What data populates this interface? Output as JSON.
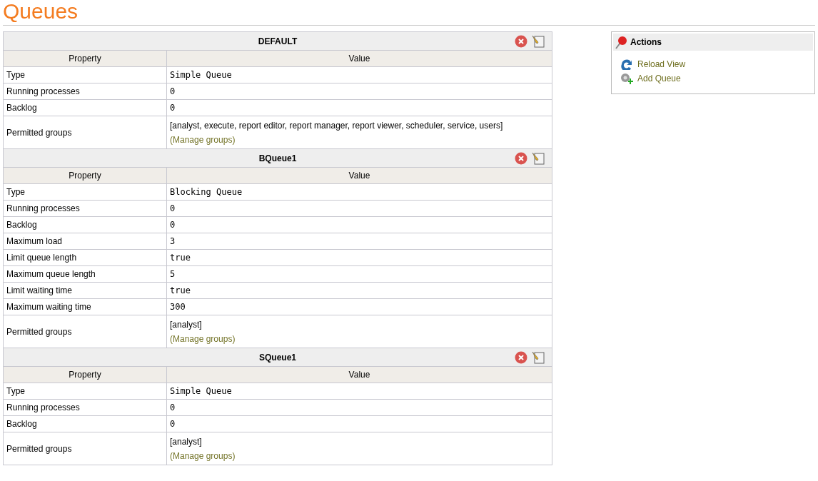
{
  "title": "Queues",
  "queues": [
    {
      "name": "DEFAULT",
      "columns": [
        "Property",
        "Value"
      ],
      "rows": [
        {
          "kind": "code",
          "property": "Type",
          "value": "Simple Queue"
        },
        {
          "kind": "code",
          "property": "Running processes",
          "value": "0"
        },
        {
          "kind": "code",
          "property": "Backlog",
          "value": "0"
        },
        {
          "kind": "groups",
          "property": "Permitted groups",
          "value": "[analyst, execute, report editor, report manager, report viewer, scheduler, service, users]",
          "link": "(Manage groups)"
        }
      ]
    },
    {
      "name": "BQueue1",
      "columns": [
        "Property",
        "Value"
      ],
      "rows": [
        {
          "kind": "code",
          "property": "Type",
          "value": "Blocking Queue"
        },
        {
          "kind": "code",
          "property": "Running processes",
          "value": "0"
        },
        {
          "kind": "code",
          "property": "Backlog",
          "value": "0"
        },
        {
          "kind": "code",
          "property": "Maximum load",
          "value": "3"
        },
        {
          "kind": "code",
          "property": "Limit queue length",
          "value": "true"
        },
        {
          "kind": "code",
          "property": "Maximum queue length",
          "value": "5"
        },
        {
          "kind": "code",
          "property": "Limit waiting time",
          "value": "true"
        },
        {
          "kind": "code",
          "property": "Maximum waiting time",
          "value": "300"
        },
        {
          "kind": "groups",
          "property": "Permitted groups",
          "value": "[analyst]",
          "link": "(Manage groups)"
        }
      ]
    },
    {
      "name": "SQueue1",
      "columns": [
        "Property",
        "Value"
      ],
      "rows": [
        {
          "kind": "code",
          "property": "Type",
          "value": "Simple Queue"
        },
        {
          "kind": "code",
          "property": "Running processes",
          "value": "0"
        },
        {
          "kind": "code",
          "property": "Backlog",
          "value": "0"
        },
        {
          "kind": "groups",
          "property": "Permitted groups",
          "value": "[analyst]",
          "link": "(Manage groups)"
        }
      ]
    }
  ],
  "actions": {
    "title": "Actions",
    "items": [
      {
        "kind": "reload",
        "label": "Reload View"
      },
      {
        "kind": "add",
        "label": "Add Queue"
      }
    ]
  }
}
